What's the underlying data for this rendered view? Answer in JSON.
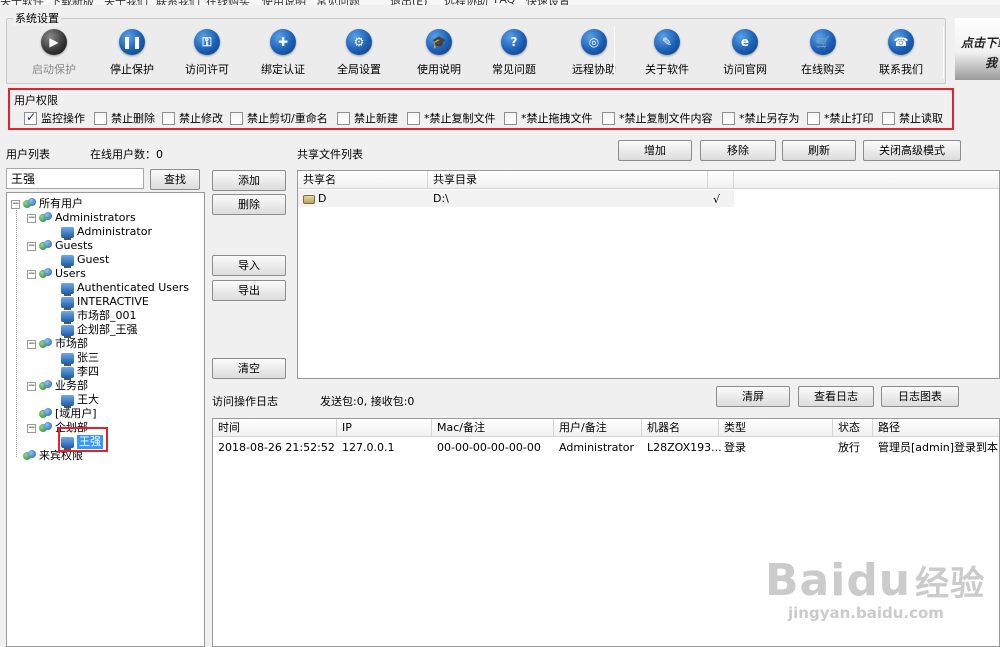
{
  "menu": {
    "items": [
      "关于软件",
      "下载新版",
      "关于我们",
      "联系我们",
      "在线购买",
      "使用说明",
      "常见问题",
      "退出(E)",
      "远程协助",
      "FAQ",
      "快速设置"
    ]
  },
  "system": {
    "title": "系统设置",
    "buttons": [
      {
        "label": "启动保护",
        "glyph": "▶",
        "disabled": true,
        "icon": "play-icon"
      },
      {
        "label": "停止保护",
        "glyph": "❚❚",
        "disabled": false,
        "icon": "pause-icon"
      },
      {
        "label": "访问许可",
        "glyph": "⚿",
        "disabled": false,
        "icon": "key-icon"
      },
      {
        "label": "绑定认证",
        "glyph": "✚",
        "disabled": false,
        "icon": "shield-icon"
      },
      {
        "label": "全局设置",
        "glyph": "⚙",
        "disabled": false,
        "icon": "gear-icon"
      },
      {
        "label": "使用说明",
        "glyph": "🎓",
        "disabled": false,
        "icon": "graduation-cap-icon"
      },
      {
        "label": "常见问题",
        "glyph": "?",
        "disabled": false,
        "icon": "question-icon"
      },
      {
        "label": "远程协助",
        "glyph": "◎",
        "disabled": false,
        "icon": "remote-globe-icon"
      },
      {
        "label": "关于软件",
        "glyph": "✎",
        "disabled": false,
        "icon": "about-icon"
      },
      {
        "label": "访问官网",
        "glyph": "e",
        "disabled": false,
        "icon": "ie-browser-icon"
      },
      {
        "label": "在线购买",
        "glyph": "🛒",
        "disabled": false,
        "icon": "cart-icon"
      },
      {
        "label": "联系我们",
        "glyph": "☎",
        "disabled": false,
        "icon": "phone-icon"
      }
    ],
    "brand_text_1": "点击下载",
    "brand_text_2": "我"
  },
  "permissions": {
    "title": "用户权限",
    "items": [
      {
        "label": "监控操作",
        "checked": true
      },
      {
        "label": "禁止删除",
        "checked": false
      },
      {
        "label": "禁止修改",
        "checked": false
      },
      {
        "label": "禁止剪切/重命名",
        "checked": false
      },
      {
        "label": "禁止新建",
        "checked": false
      },
      {
        "label": "*禁止复制文件",
        "checked": false
      },
      {
        "label": "*禁止拖拽文件",
        "checked": false
      },
      {
        "label": "*禁止复制文件内容",
        "checked": false
      },
      {
        "label": "*禁止另存为",
        "checked": false
      },
      {
        "label": "*禁止打印",
        "checked": false
      },
      {
        "label": "禁止读取",
        "checked": false
      }
    ]
  },
  "users": {
    "list_label": "用户列表",
    "online_label": "在线用户数：0",
    "search_value": "王强",
    "search_button": "查找",
    "tree": [
      {
        "label": "所有用户",
        "type": "group",
        "level": 0,
        "toggle": "−"
      },
      {
        "label": "Administrators",
        "type": "group",
        "level": 1,
        "toggle": "−"
      },
      {
        "label": "Administrator",
        "type": "user",
        "level": 2
      },
      {
        "label": "Guests",
        "type": "group",
        "level": 1,
        "toggle": "−"
      },
      {
        "label": "Guest",
        "type": "user",
        "level": 2
      },
      {
        "label": "Users",
        "type": "group",
        "level": 1,
        "toggle": "−"
      },
      {
        "label": "Authenticated Users",
        "type": "user",
        "level": 2
      },
      {
        "label": "INTERACTIVE",
        "type": "user",
        "level": 2
      },
      {
        "label": "市场部_001",
        "type": "user",
        "level": 2
      },
      {
        "label": "企划部_王强",
        "type": "user",
        "level": 2
      },
      {
        "label": "市场部",
        "type": "group",
        "level": 1,
        "toggle": "−"
      },
      {
        "label": "张三",
        "type": "user",
        "level": 2
      },
      {
        "label": "李四",
        "type": "user",
        "level": 2
      },
      {
        "label": "业务部",
        "type": "group",
        "level": 1,
        "toggle": "−"
      },
      {
        "label": "王大",
        "type": "user",
        "level": 2
      },
      {
        "label": "[域用户]",
        "type": "group",
        "level": 1,
        "toggle": ""
      },
      {
        "label": "企划部",
        "type": "group",
        "level": 1,
        "toggle": "−"
      },
      {
        "label": "王强",
        "type": "user",
        "level": 2,
        "selected": true
      },
      {
        "label": "来宾权限",
        "type": "group",
        "level": 0,
        "toggle": ""
      }
    ]
  },
  "actions": {
    "add": "添加",
    "delete": "删除",
    "import": "导入",
    "export": "导出",
    "clear": "清空"
  },
  "shares": {
    "title": "共享文件列表",
    "buttons": {
      "add": "增加",
      "remove": "移除",
      "refresh": "刷新",
      "close_advanced": "关闭高级模式"
    },
    "columns": [
      "共享名",
      "共享目录",
      ""
    ],
    "rows": [
      {
        "name": "D",
        "path": "D:\\",
        "flag": "√"
      }
    ]
  },
  "log": {
    "title": "访问操作日志",
    "packets": "发送包:0, 接收包:0",
    "buttons": {
      "clear": "清屏",
      "view": "查看日志",
      "chart": "日志图表"
    },
    "columns": [
      "时间",
      "IP",
      "Mac/备注",
      "用户/备注",
      "机器名",
      "类型",
      "状态",
      "路径"
    ],
    "rows": [
      [
        "2018-08-26 21:52:52",
        "127.0.0.1",
        "00-00-00-00-00-00",
        "Administrator",
        "L28ZOX193...",
        "登录",
        "放行",
        "管理员[admin]登录到本系统"
      ]
    ]
  },
  "watermark": {
    "main": "Bai",
    "paw": "du",
    "cn": "经验",
    "url": "jingyan.baidu.com"
  }
}
